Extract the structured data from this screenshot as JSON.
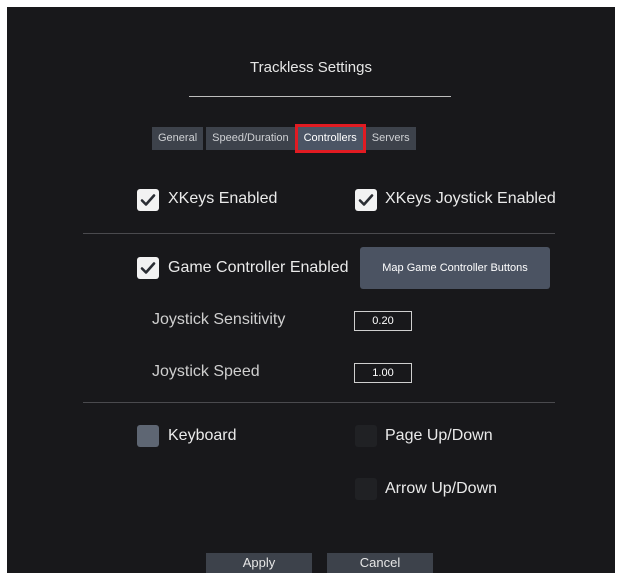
{
  "window": {
    "title": "Trackless Settings"
  },
  "tabs": [
    {
      "label": "General",
      "active": false
    },
    {
      "label": "Speed/Duration",
      "active": false
    },
    {
      "label": "Controllers",
      "active": true
    },
    {
      "label": "Servers",
      "active": false
    }
  ],
  "xkeys": {
    "enabled": {
      "label": "XKeys Enabled",
      "checked": true
    },
    "joystick_enabled": {
      "label": "XKeys Joystick Enabled",
      "checked": true
    }
  },
  "game_controller": {
    "enabled": {
      "label": "Game Controller Enabled",
      "checked": true
    },
    "map_button_label": "Map Game Controller Buttons",
    "sensitivity": {
      "label": "Joystick Sensitivity",
      "value": "0.20"
    },
    "speed": {
      "label": "Joystick Speed",
      "value": "1.00"
    }
  },
  "keyboard": {
    "keyboard": {
      "label": "Keyboard",
      "checked": false
    },
    "page_up_down": {
      "label": "Page Up/Down",
      "checked": false
    },
    "arrow_up_down": {
      "label": "Arrow Up/Down",
      "checked": false
    }
  },
  "footer": {
    "apply_label": "Apply",
    "cancel_label": "Cancel"
  },
  "colors": {
    "background": "#18181b",
    "accent_tab_outline": "#e11b22",
    "button": "#4b5362"
  }
}
